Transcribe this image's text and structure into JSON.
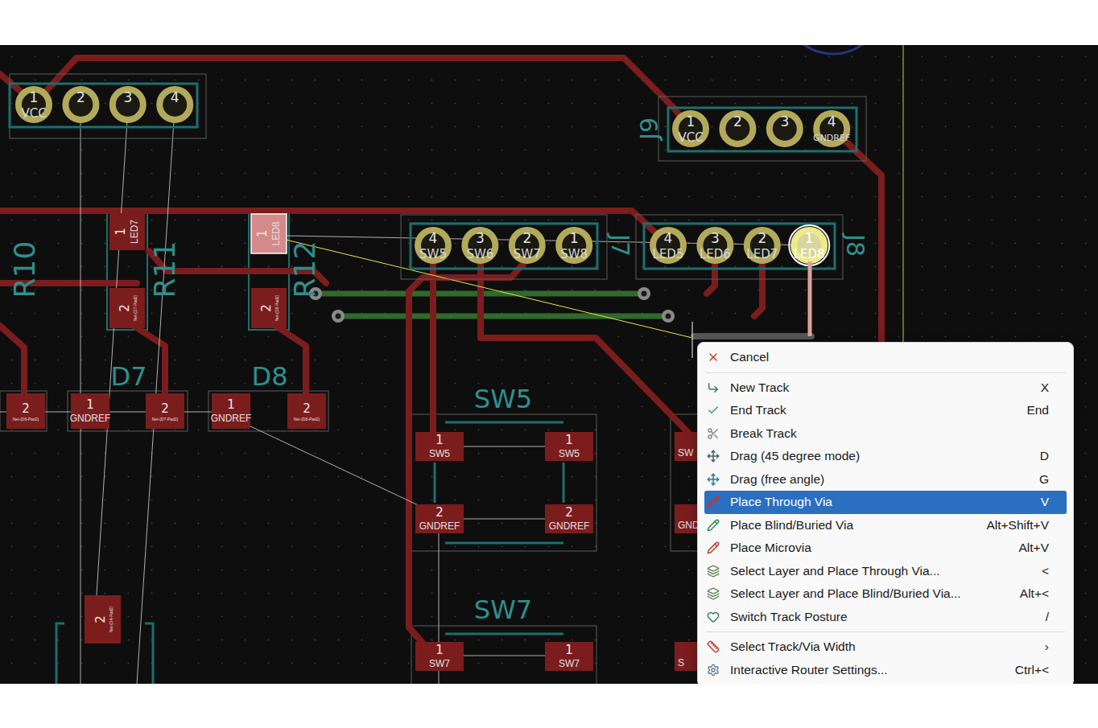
{
  "board": {
    "headers": [
      {
        "ref": "",
        "pins": [
          {
            "number": "1",
            "net": "VCC",
            "selected": false
          },
          {
            "number": "2",
            "net": "",
            "selected": false
          },
          {
            "number": "3",
            "net": "",
            "selected": false
          },
          {
            "number": "4",
            "net": "",
            "selected": false
          }
        ]
      },
      {
        "ref": "J9",
        "pins": [
          {
            "number": "1",
            "net": "VCC",
            "selected": false
          },
          {
            "number": "2",
            "net": "",
            "selected": false
          },
          {
            "number": "3",
            "net": "",
            "selected": false
          },
          {
            "number": "4",
            "net": "GNDREF",
            "selected": false
          }
        ]
      },
      {
        "ref": "J7",
        "pins": [
          {
            "number": "4",
            "net": "SW5",
            "selected": false
          },
          {
            "number": "3",
            "net": "SW6",
            "selected": false
          },
          {
            "number": "2",
            "net": "SW7",
            "selected": false
          },
          {
            "number": "1",
            "net": "SW8",
            "selected": false
          }
        ]
      },
      {
        "ref": "J8",
        "pins": [
          {
            "number": "4",
            "net": "LED5",
            "selected": false
          },
          {
            "number": "3",
            "net": "LED6",
            "selected": false
          },
          {
            "number": "2",
            "net": "LED7",
            "selected": false
          },
          {
            "number": "1",
            "net": "LED8",
            "selected": true
          }
        ]
      }
    ],
    "ref_labels": [
      "R10",
      "R11",
      "R12",
      "D7",
      "D8",
      "SW5",
      "SW7"
    ],
    "pads": [
      {
        "number": "1",
        "net": "LED7",
        "selected": false
      },
      {
        "number": "2",
        "net": "Net-(D7-Pad2)",
        "selected": false
      },
      {
        "number": "1",
        "net": "LED8",
        "selected": true
      },
      {
        "number": "2",
        "net": "Net-(D8-Pad2)",
        "selected": false
      },
      {
        "number": "2",
        "net": "Net-(D6-Pad2)",
        "selected": false
      },
      {
        "number": "1",
        "net": "GNDREF",
        "selected": false
      },
      {
        "number": "2",
        "net": "Net-(D7-Pad2)",
        "selected": false
      },
      {
        "number": "1",
        "net": "GNDREF",
        "selected": false
      },
      {
        "number": "2",
        "net": "Net-(D8-Pad2)",
        "selected": false
      },
      {
        "number": "1",
        "net": "SW5",
        "selected": false
      },
      {
        "number": "1",
        "net": "SW5",
        "selected": false
      },
      {
        "number": "2",
        "net": "GNDREF",
        "selected": false
      },
      {
        "number": "2",
        "net": "GNDREF",
        "selected": false
      },
      {
        "number": "1",
        "net": "SW7",
        "selected": false
      },
      {
        "number": "1",
        "net": "SW7",
        "selected": false
      },
      {
        "number": "2",
        "net": "Net-(D4-Pad2)",
        "selected": false
      },
      {
        "number": "",
        "net": "SW",
        "selected": false
      },
      {
        "number": "",
        "net": "GND",
        "selected": false
      },
      {
        "number": "",
        "net": "S",
        "selected": false
      }
    ]
  },
  "menu": {
    "groups": [
      [
        {
          "label": "Cancel",
          "shortcut": "",
          "selected": false
        }
      ],
      [
        {
          "label": "New Track",
          "shortcut": "X",
          "selected": false
        },
        {
          "label": "End Track",
          "shortcut": "End",
          "selected": false
        },
        {
          "label": "Break Track",
          "shortcut": "",
          "selected": false
        },
        {
          "label": "Drag (45 degree mode)",
          "shortcut": "D",
          "selected": false
        },
        {
          "label": "Drag (free angle)",
          "shortcut": "G",
          "selected": false
        },
        {
          "label": "Place Through Via",
          "shortcut": "V",
          "selected": true
        },
        {
          "label": "Place Blind/Buried Via",
          "shortcut": "Alt+Shift+V",
          "selected": false
        },
        {
          "label": "Place Microvia",
          "shortcut": "Alt+V",
          "selected": false
        },
        {
          "label": "Select Layer and Place Through Via...",
          "shortcut": "<",
          "selected": false
        },
        {
          "label": "Select Layer and Place Blind/Buried Via...",
          "shortcut": "Alt+<",
          "selected": false
        },
        {
          "label": "Switch Track Posture",
          "shortcut": "/",
          "selected": false
        }
      ],
      [
        {
          "label": "Select Track/Via Width",
          "shortcut": "›",
          "selected": false
        },
        {
          "label": "Interactive Router Settings...",
          "shortcut": "Ctrl+<",
          "selected": false
        }
      ]
    ]
  }
}
